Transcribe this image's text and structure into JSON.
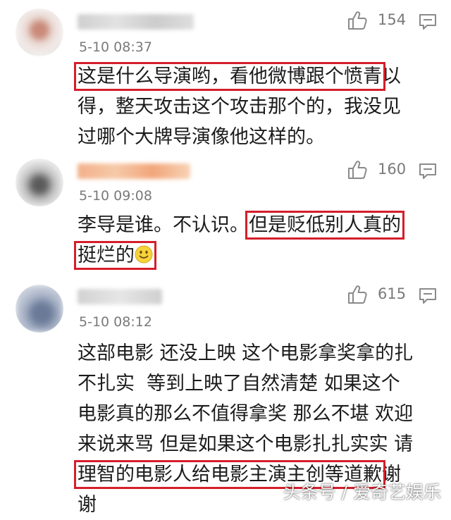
{
  "comments": [
    {
      "time": "5-10 08:37",
      "likes": "154",
      "line1_highlight": "这是什么导演哟，看他微博跟个愤青",
      "line1_rest": "以",
      "line2": "得，整天攻击这个攻击那个的，我没见",
      "line3": "过哪个大牌导演像他这样的。"
    },
    {
      "time": "5-10 09:08",
      "likes": "160",
      "line1_plain": "李导是谁。不认识。",
      "line1_highlight": "但是贬低别人真的",
      "line2_highlight": "挺烂的"
    },
    {
      "time": "5-10 08:12",
      "likes": "615",
      "line1": "这部电影 还没上映 这个电影拿奖拿的扎",
      "line2": "不扎实  等到上映了自然清楚 如果这个",
      "line3": "电影真的那么不值得拿奖 那么不堪 欢迎",
      "line4": "来说来骂 但是如果这个电影扎扎实实 请",
      "line5_highlight": "理智的电影人给电影主演主创等道歉",
      "line5_rest": "谢",
      "line6": "谢"
    }
  ],
  "watermark": "头条号 / 爱奇艺娱乐",
  "colors": {
    "highlight": "#d41e2a",
    "meta": "#7a7a7a"
  },
  "icons": [
    "thumbs-up-icon",
    "reply-icon",
    "smiley-icon"
  ]
}
